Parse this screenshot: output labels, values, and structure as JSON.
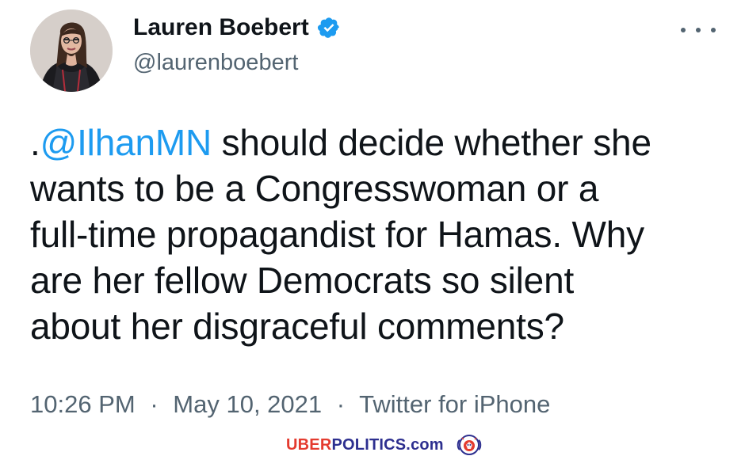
{
  "author": {
    "name": "Lauren Boebert",
    "handle": "@laurenboebert",
    "verified_icon": "verified-badge-icon",
    "avatar_icon": "avatar"
  },
  "tweet": {
    "prefix": ".",
    "mention": "@IlhanMN",
    "line1_rest": " should decide whether she",
    "line2": "wants to be a Congresswoman or a",
    "line3": "full-time propagandist for Hamas. Why",
    "line4": "are her fellow Democrats so silent",
    "line5": "about her disgraceful comments?"
  },
  "meta": {
    "time": "10:26 PM",
    "separator": "·",
    "date": "May 10, 2021",
    "source": "Twitter for iPhone"
  },
  "actions": {
    "more_icon": "more-options-icon"
  },
  "watermark": {
    "red_text": "UBER",
    "blue_text": "POLITICS.com"
  },
  "colors": {
    "text_primary": "#0f1419",
    "text_secondary": "#536471",
    "mention_blue": "#1d9bf0",
    "verified_blue": "#1d9bf0",
    "watermark_red": "#e43b2f",
    "watermark_blue": "#2d2f8f"
  }
}
